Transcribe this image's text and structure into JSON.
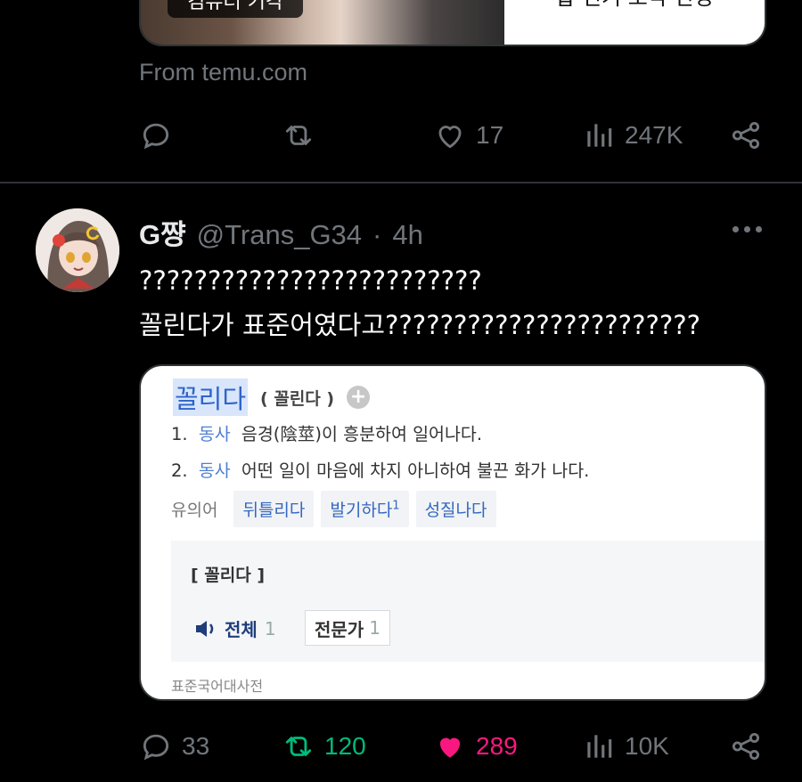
{
  "prev_tweet": {
    "image_label": "컴퓨터 기각",
    "side_text": "탑 인기 조각 인정",
    "source": "From temu.com",
    "actions": {
      "reply": "",
      "retweet": "",
      "like": "17",
      "views": "247K"
    }
  },
  "tweet": {
    "display_name": "G쨩",
    "handle": "@Trans_G34",
    "separator": "·",
    "time": "4h",
    "text_line1": "?????????????????????????",
    "text_line2": "꼴린다가 표준어였다고???????????????????????",
    "card": {
      "headword": "꼴리다",
      "reading": "( 꼴린다 )",
      "plus": "+",
      "senses": [
        {
          "num": "1.",
          "pos": "동사",
          "text": "음경(陰莖)이 흥분하여 일어나다."
        },
        {
          "num": "2.",
          "pos": "동사",
          "text": "어떤 일이 마음에 차지 아니하여 불끈 화가 나다."
        }
      ],
      "synonym_label": "유의어",
      "synonyms": [
        "뒤틀리다",
        "발기하다",
        "성질나다"
      ],
      "synonym_sup": "1",
      "pron_word": "[ 꼴리다 ]",
      "pron_all_label": "전체",
      "pron_all_count": "1",
      "pron_expert_label": "전문가",
      "pron_expert_count": "1",
      "source": "표준국어대사전"
    },
    "actions": {
      "reply": "33",
      "retweet": "120",
      "like": "289",
      "views": "10K"
    }
  },
  "colors": {
    "background": "#000000",
    "muted": "#71767b",
    "retweet_active": "#00ba7c",
    "like_active": "#f91880",
    "dict_link": "#4f7fd0"
  }
}
